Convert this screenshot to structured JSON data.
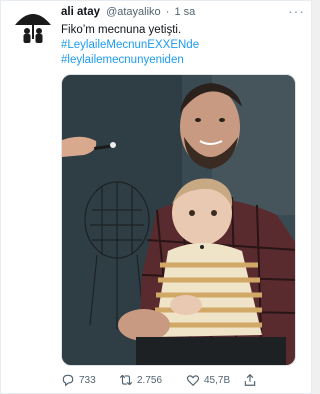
{
  "tweet": {
    "author_name": "ali atay",
    "author_handle": "@atayaliko",
    "separator": "·",
    "time": "1 sa",
    "text": "Fiko’m mecnuna yetişti.",
    "hashtags": [
      "#LeylaileMecnunEXXENde",
      "#leylailemecnunyeniden"
    ]
  },
  "actions": {
    "replies": "733",
    "retweets": "2.756",
    "likes": "45,7B"
  },
  "icons": {
    "reply": "reply-icon",
    "retweet": "retweet-icon",
    "like": "heart-icon",
    "share": "share-icon",
    "more": "more-icon"
  },
  "colors": {
    "link": "#1d9bf0",
    "text": "#0f1419",
    "muted": "#536471"
  }
}
